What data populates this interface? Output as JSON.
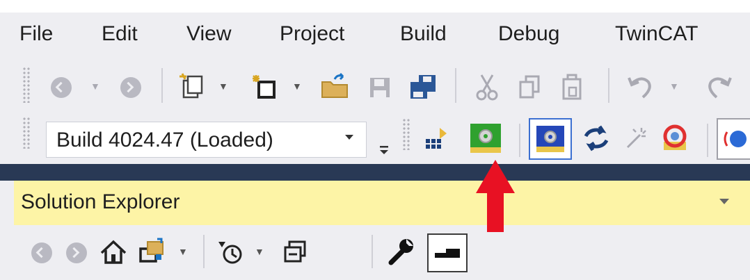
{
  "menu": {
    "items": [
      "File",
      "Edit",
      "View",
      "Project",
      "Build",
      "Debug",
      "TwinCAT"
    ]
  },
  "toolbar1": {
    "icons": [
      "navigate-back-icon",
      "dropdown-arrow-icon",
      "navigate-forward-icon",
      "new-project-icon",
      "add-item-icon",
      "open-folder-icon",
      "save-icon",
      "save-all-icon",
      "cut-icon",
      "copy-icon",
      "paste-icon",
      "undo-icon",
      "redo-icon"
    ]
  },
  "toolbar2": {
    "config_value": "Build 4024.47 (Loaded)",
    "icons": [
      "customize-icon",
      "add-target-icon",
      "activate-configuration-icon",
      "restart-twincat-config-icon",
      "reload-devices-icon",
      "scan-wand-icon",
      "toggle-free-run-icon"
    ]
  },
  "solution_explorer": {
    "title": "Solution Explorer",
    "icons": [
      "back-icon",
      "forward-icon",
      "home-icon",
      "switch-views-icon",
      "pending-changes-icon",
      "collapse-all-icon",
      "properties-wrench-icon",
      "preview-selected-icon"
    ]
  },
  "annotation": {
    "arrow_color": "#e81123"
  }
}
